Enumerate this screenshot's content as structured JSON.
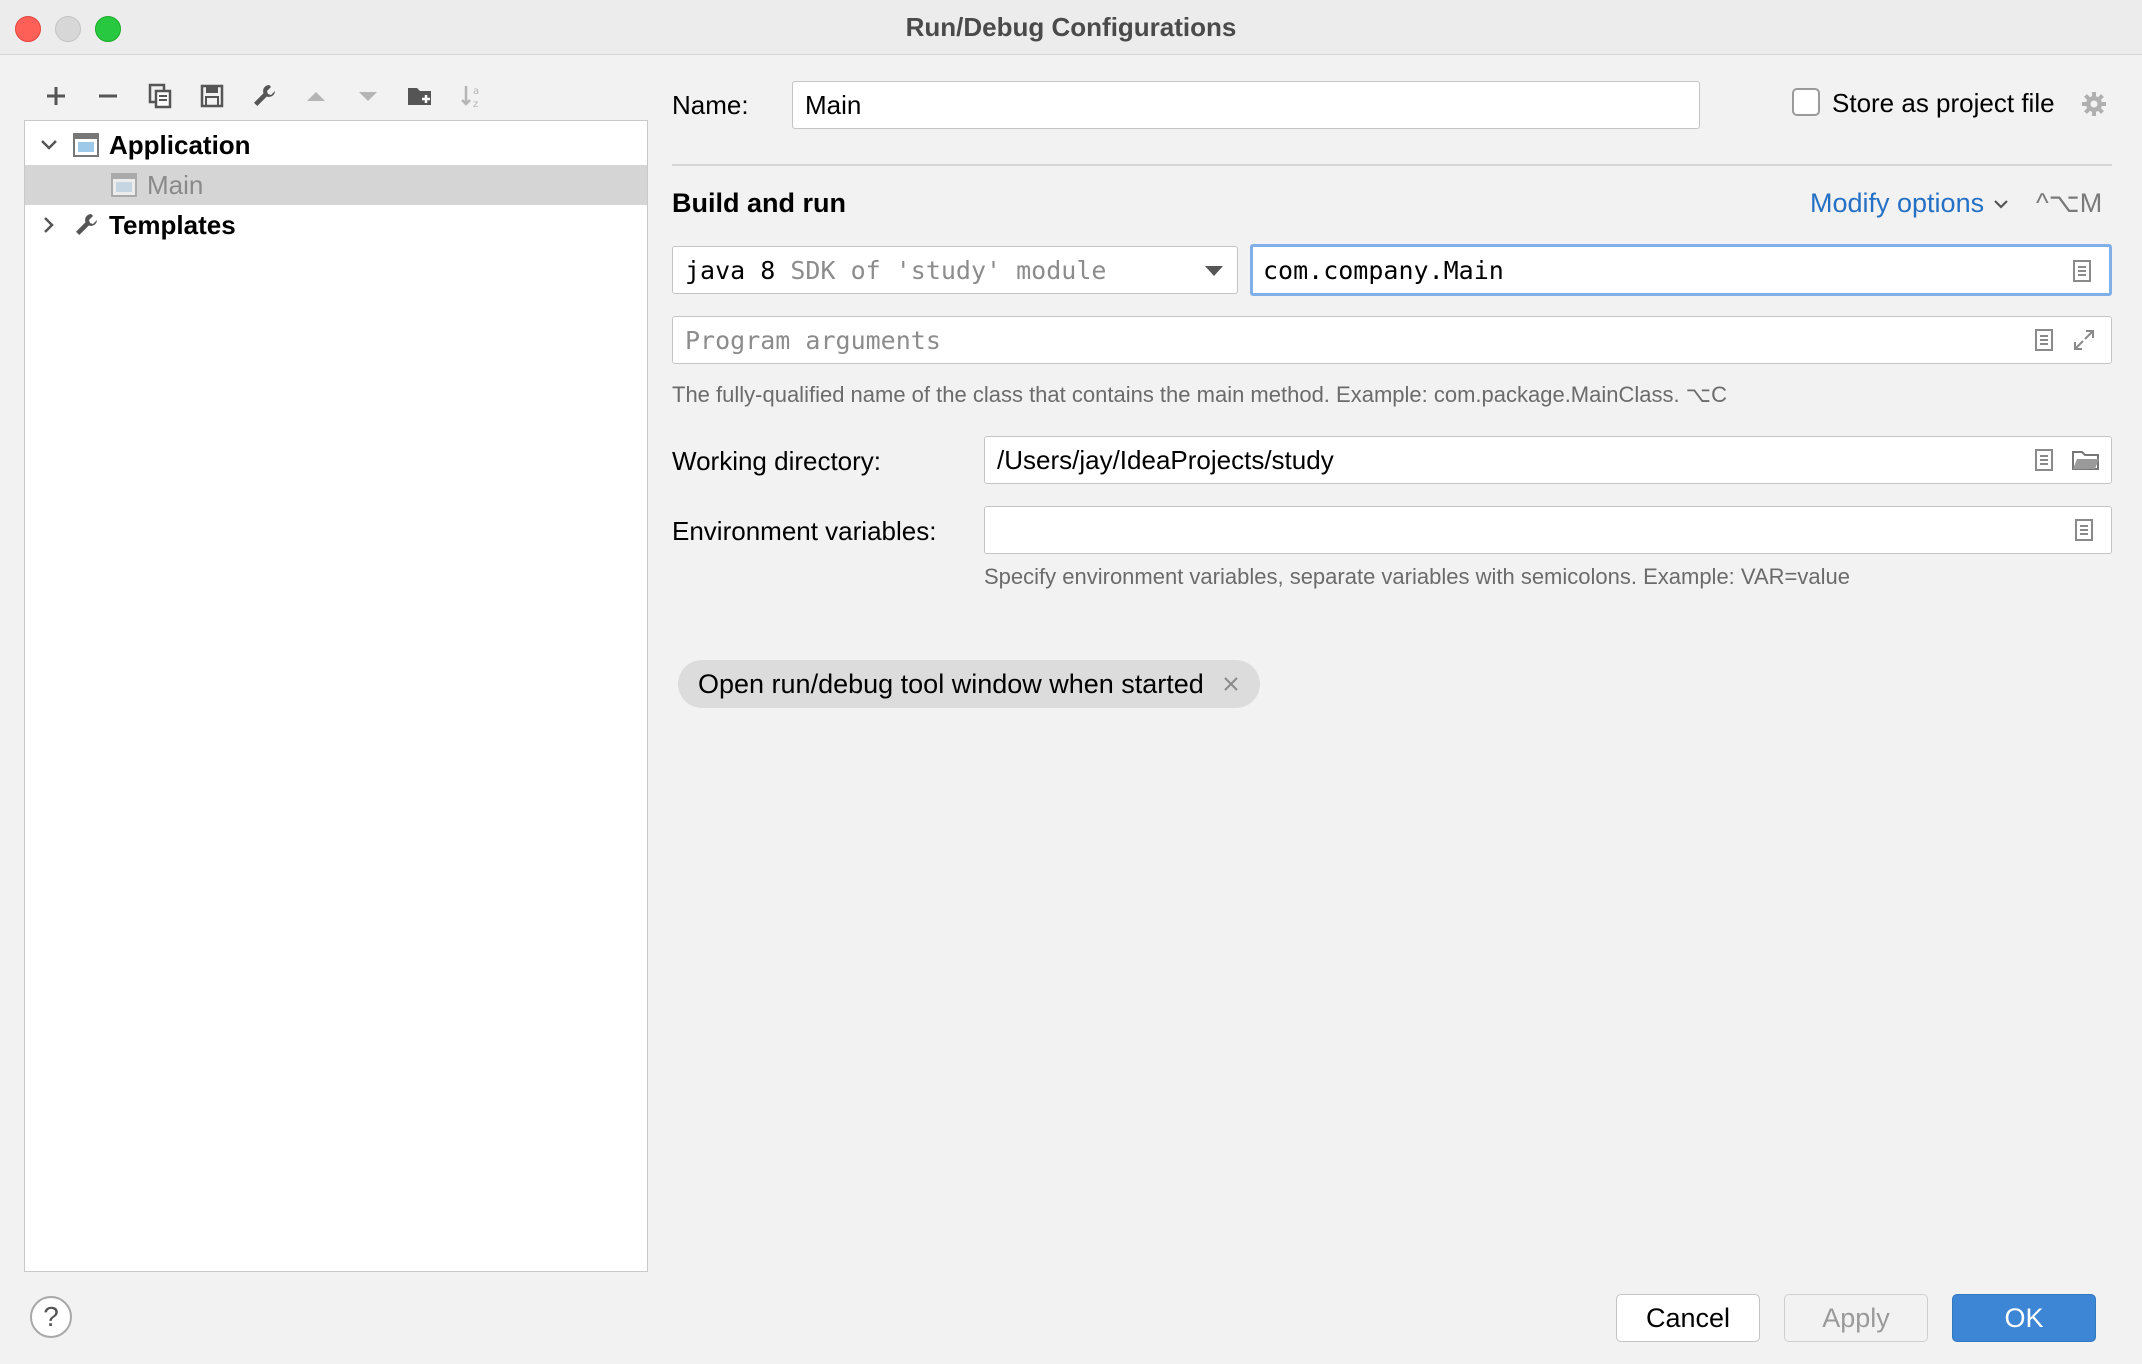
{
  "window": {
    "title": "Run/Debug Configurations"
  },
  "toolbar": {
    "icons": [
      "add-icon",
      "remove-icon",
      "copy-icon",
      "save-icon",
      "wrench-icon",
      "move-up-icon",
      "move-down-icon",
      "new-folder-icon",
      "sort-icon"
    ]
  },
  "tree": {
    "items": [
      {
        "label": "Application",
        "expanded": true,
        "icon": "application-icon"
      },
      {
        "label": "Main",
        "selected": true,
        "icon": "application-icon"
      },
      {
        "label": "Templates",
        "expanded": false,
        "icon": "wrench-icon"
      }
    ]
  },
  "form": {
    "name_label": "Name:",
    "name_value": "Main",
    "store_as_project_file": "Store as project file",
    "section_title": "Build and run",
    "modify_options": "Modify options",
    "modify_shortcut": "^⌥M",
    "sdk_bold": "java 8",
    "sdk_rest": " SDK of 'study' module",
    "main_class_value": "com.company.Main",
    "program_args_placeholder": "Program arguments",
    "main_class_hint": "The fully-qualified name of the class that contains the main method. Example: com.package.MainClass. ⌥C",
    "working_dir_label": "Working directory:",
    "working_dir_value": "/Users/jay/IdeaProjects/study",
    "env_label": "Environment variables:",
    "env_value": "",
    "env_hint": "Specify environment variables, separate variables with semicolons. Example: VAR=value",
    "chip_label": "Open run/debug tool window when started"
  },
  "footer": {
    "help": "?",
    "cancel": "Cancel",
    "apply": "Apply",
    "ok": "OK"
  },
  "colors": {
    "accent": "#3d86d5",
    "link": "#2470c4",
    "selection": "#d5d5d5"
  }
}
